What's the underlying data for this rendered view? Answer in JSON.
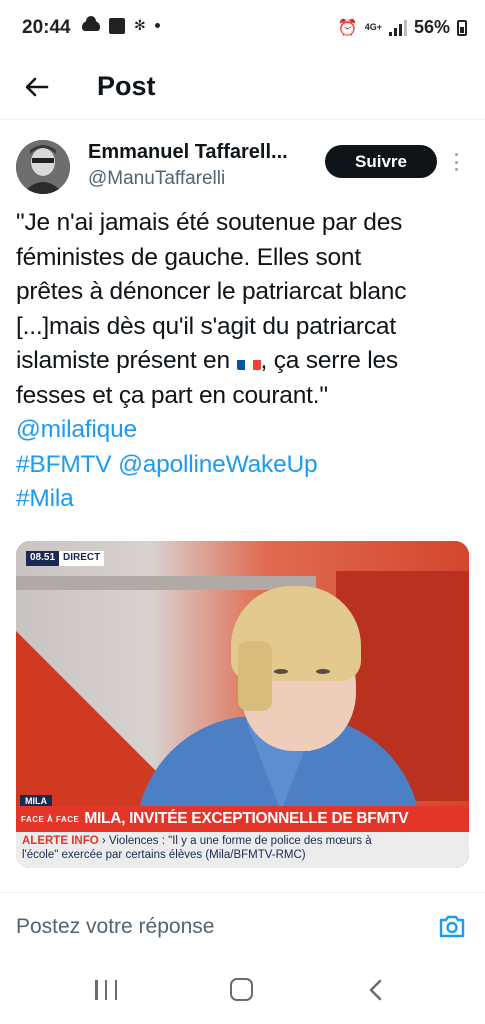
{
  "status_bar": {
    "time": "20:44",
    "network": "4G+",
    "battery": "56%"
  },
  "header": {
    "title": "Post"
  },
  "post": {
    "author_name": "Emmanuel Taffarell...",
    "author_handle": "@ManuTaffarelli",
    "follow_label": "Suivre",
    "text_lines": [
      "\"Je n'ai jamais été soutenue par des",
      "féministes de gauche. Elles sont",
      "prêtes à dénoncer le patriarcat blanc",
      "[...]mais dès qu'il s'agit du patriarcat",
      "islamiste présent en",
      ", ça serre les",
      "fesses et ça part en courant.\""
    ],
    "mention_1": "@milafique",
    "hashtag_1": "#BFMTV",
    "mention_2": "@apollineWakeUp",
    "hashtag_2": "#Mila"
  },
  "media": {
    "tv_time": "08.51",
    "tv_direct": "DIRECT",
    "tv_tag": "MILA",
    "tv_face": "FACE À FACE",
    "tv_headline": "MILA, INVITÉE EXCEPTIONNELLE DE BFMTV",
    "tv_alert_label": "ALERTE INFO",
    "tv_alert_text_1": "Violences : \"Il y a une forme de police des mœurs à",
    "tv_alert_text_2": "l'école\" exercée par certains élèves (Mila/BFMTV-RMC)"
  },
  "reply": {
    "placeholder": "Postez votre réponse"
  },
  "colors": {
    "link": "#1d9bf0",
    "text": "#0f1419",
    "secondary": "#536471"
  }
}
